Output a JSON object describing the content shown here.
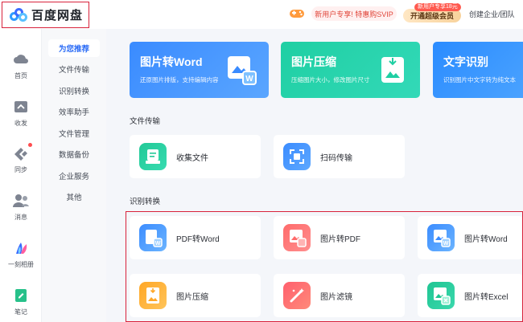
{
  "header": {
    "logo_text": "百度网盘",
    "promo_text": "新用户专享! 特惠购SVIP",
    "vip_badge": "新用户专享18元",
    "vip_button": "开通超级会员",
    "team_link": "创建企业/团队"
  },
  "left_nav": [
    {
      "label": "首页",
      "icon": "cloud-icon"
    },
    {
      "label": "收发",
      "icon": "share-icon"
    },
    {
      "label": "同步",
      "icon": "sync-icon"
    },
    {
      "label": "消息",
      "icon": "message-icon"
    },
    {
      "label": "一刻相册",
      "icon": "album-icon"
    },
    {
      "label": "笔记",
      "icon": "note-icon"
    }
  ],
  "sub_nav": [
    {
      "label": "为您推荐",
      "active": true
    },
    {
      "label": "文件传输"
    },
    {
      "label": "识别转换"
    },
    {
      "label": "效率助手"
    },
    {
      "label": "文件管理"
    },
    {
      "label": "数据备份"
    },
    {
      "label": "企业服务"
    },
    {
      "label": "其他"
    }
  ],
  "banners": [
    {
      "title": "图片转Word",
      "desc": "还原图片排版，支持编辑内容",
      "color": "#3a8bff"
    },
    {
      "title": "图片压缩",
      "desc": "压缩图片大小，修改图片尺寸",
      "color": "#1fcfa3"
    },
    {
      "title": "文字识别",
      "desc": "识别图片中文字转为纯文本",
      "color": "#2b8cff"
    }
  ],
  "sections": {
    "transfer_title": "文件传输",
    "recognize_title": "识别转换"
  },
  "transfer_cards": [
    {
      "label": "收集文件",
      "icon": "collect-file-icon"
    },
    {
      "label": "扫码传输",
      "icon": "scan-transfer-icon"
    }
  ],
  "recognize_cards": [
    {
      "label": "PDF转Word",
      "icon": "pdf-to-word-icon"
    },
    {
      "label": "图片转PDF",
      "icon": "image-to-pdf-icon"
    },
    {
      "label": "图片转Word",
      "icon": "image-to-word-icon"
    },
    {
      "label": "图片压缩",
      "icon": "image-compress-icon"
    },
    {
      "label": "图片滤镜",
      "icon": "image-filter-icon"
    },
    {
      "label": "图片转Excel",
      "icon": "image-to-excel-icon"
    }
  ]
}
